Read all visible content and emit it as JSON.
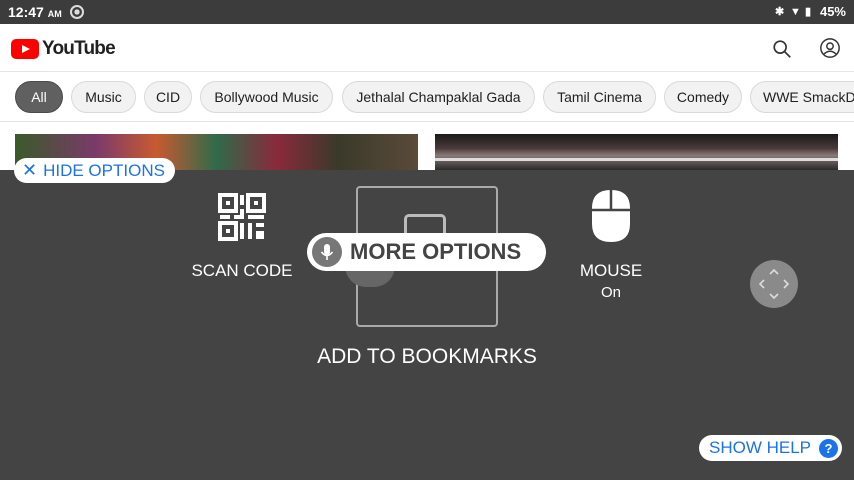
{
  "status_bar": {
    "time": "12:47",
    "ampm": "AM",
    "battery": "45%"
  },
  "youtube": {
    "logo_text": "YouTube",
    "chips": [
      "All",
      "Music",
      "CID",
      "Bollywood Music",
      "Jethalal Champaklal Gada",
      "Tamil Cinema",
      "Comedy",
      "WWE SmackDown"
    ],
    "active_chip": "All"
  },
  "overlay": {
    "hide_options": "HIDE OPTIONS",
    "scan_code": "SCAN CODE",
    "more_options": "MORE OPTIONS",
    "add_to_bookmarks": "ADD TO BOOKMARKS",
    "mouse_label": "MOUSE",
    "mouse_state": "On",
    "show_help": "SHOW HELP",
    "help_glyph": "?"
  },
  "colors": {
    "accent": "#1a73e8",
    "overlay_bg": "#444444",
    "youtube_red": "#ff0000"
  }
}
